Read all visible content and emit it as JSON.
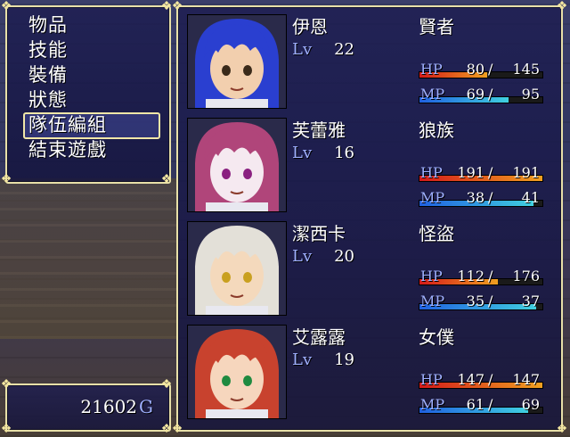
{
  "menu": {
    "items": [
      "物品",
      "技能",
      "裝備",
      "狀態",
      "隊伍編組",
      "結束遊戲"
    ],
    "selected_index": 4
  },
  "gold": {
    "amount": "21602",
    "unit": "G"
  },
  "party": [
    {
      "name": "伊恩",
      "class": "賢者",
      "lv_label": "Lv",
      "level": "22",
      "hp_label": "HP",
      "hp": "80",
      "hp_max": "145",
      "mp_label": "MP",
      "mp": "69",
      "mp_max": "95",
      "hair_color": "#2a3fd0",
      "fur_color": "#f2cfae",
      "eye_color": "#3a2a1a"
    },
    {
      "name": "芙蕾雅",
      "class": "狼族",
      "lv_label": "Lv",
      "level": "16",
      "hp_label": "HP",
      "hp": "191",
      "hp_max": "191",
      "mp_label": "MP",
      "mp": "38",
      "mp_max": "41",
      "hair_color": "#b0457a",
      "fur_color": "#f5e9f0",
      "eye_color": "#8a2080"
    },
    {
      "name": "潔西卡",
      "class": "怪盜",
      "lv_label": "Lv",
      "level": "20",
      "hp_label": "HP",
      "hp": "112",
      "hp_max": "176",
      "mp_label": "MP",
      "mp": "35",
      "mp_max": "37",
      "hair_color": "#e3e0d8",
      "fur_color": "#f4d9bc",
      "eye_color": "#c9a020"
    },
    {
      "name": "艾露露",
      "class": "女僕",
      "lv_label": "Lv",
      "level": "19",
      "hp_label": "HP",
      "hp": "147",
      "hp_max": "147",
      "mp_label": "MP",
      "mp": "61",
      "mp_max": "69",
      "hair_color": "#c8422e",
      "fur_color": "#f6d6bd",
      "eye_color": "#1f8a40"
    }
  ],
  "colors": {
    "hp_gradient": [
      "#d41a1a",
      "#f0a020"
    ],
    "mp_gradient": [
      "#2060e0",
      "#40d0e0"
    ],
    "window_border": "#e8e0a8",
    "label_blue": "#9fb0ff"
  }
}
